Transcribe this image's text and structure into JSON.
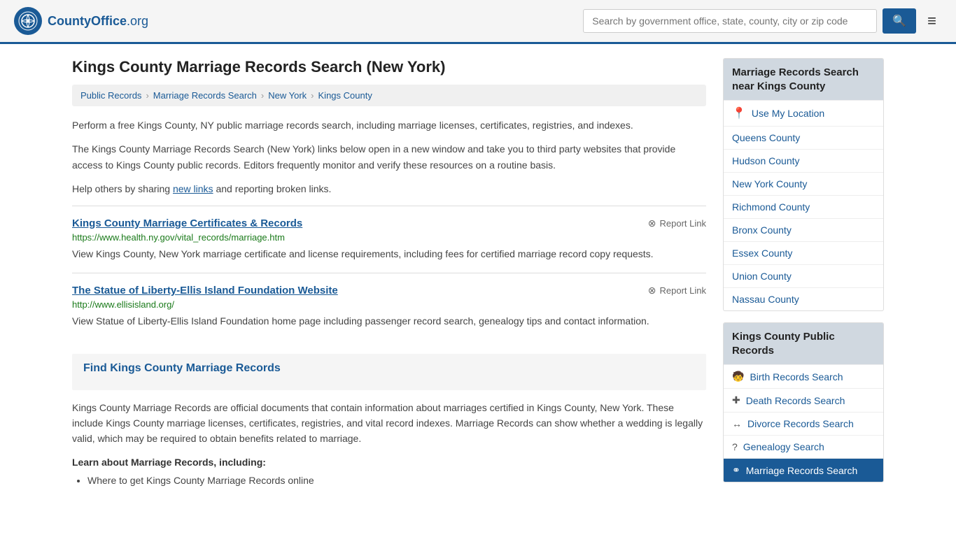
{
  "header": {
    "logo_text": "CountyOffice",
    "logo_org": ".org",
    "search_placeholder": "Search by government office, state, county, city or zip code"
  },
  "page": {
    "title": "Kings County Marriage Records Search (New York)",
    "breadcrumb": [
      {
        "label": "Public Records",
        "href": "#"
      },
      {
        "label": "Marriage Records Search",
        "href": "#"
      },
      {
        "label": "New York",
        "href": "#"
      },
      {
        "label": "Kings County",
        "href": "#"
      }
    ],
    "intro1": "Perform a free Kings County, NY public marriage records search, including marriage licenses, certificates, registries, and indexes.",
    "intro2": "The Kings County Marriage Records Search (New York) links below open in a new window and take you to third party websites that provide access to Kings County public records. Editors frequently monitor and verify these resources on a routine basis.",
    "intro3_pre": "Help others by sharing ",
    "intro3_link": "new links",
    "intro3_post": " and reporting broken links.",
    "results": [
      {
        "title": "Kings County Marriage Certificates & Records",
        "url": "https://www.health.ny.gov/vital_records/marriage.htm",
        "desc": "View Kings County, New York marriage certificate and license requirements, including fees for certified marriage record copy requests.",
        "report_label": "Report Link"
      },
      {
        "title": "The Statue of Liberty-Ellis Island Foundation Website",
        "url": "http://www.ellisisland.org/",
        "desc": "View Statue of Liberty-Ellis Island Foundation home page including passenger record search, genealogy tips and contact information.",
        "report_label": "Report Link"
      }
    ],
    "find_section_title": "Find Kings County Marriage Records",
    "find_section_body": "Kings County Marriage Records are official documents that contain information about marriages certified in Kings County, New York. These include Kings County marriage licenses, certificates, registries, and vital record indexes. Marriage Records can show whether a wedding is legally valid, which may be required to obtain benefits related to marriage.",
    "learn_title": "Learn about Marriage Records, including:",
    "bullets": [
      "Where to get Kings County Marriage Records online"
    ]
  },
  "sidebar": {
    "nearby_heading": "Marriage Records Search near Kings County",
    "use_my_location": "Use My Location",
    "nearby_counties": [
      {
        "name": "Queens County"
      },
      {
        "name": "Hudson County"
      },
      {
        "name": "New York County"
      },
      {
        "name": "Richmond County"
      },
      {
        "name": "Bronx County"
      },
      {
        "name": "Essex County"
      },
      {
        "name": "Union County"
      },
      {
        "name": "Nassau County"
      }
    ],
    "public_records_heading": "Kings County Public Records",
    "public_records": [
      {
        "name": "Birth Records Search",
        "icon": "👶"
      },
      {
        "name": "Death Records Search",
        "icon": "✚"
      },
      {
        "name": "Divorce Records Search",
        "icon": "↔"
      },
      {
        "name": "Genealogy Search",
        "icon": "?"
      },
      {
        "name": "Marriage Records Search",
        "icon": "⚭"
      }
    ]
  }
}
